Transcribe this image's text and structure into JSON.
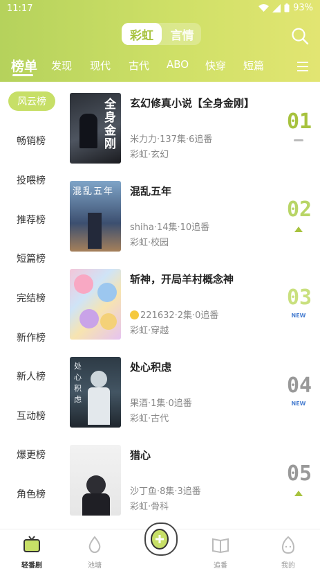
{
  "status": {
    "time": "11:17",
    "battery": "93%"
  },
  "header": {
    "segment": {
      "active": "彩虹",
      "inactive": "言情"
    },
    "tabs": [
      "榜单",
      "发现",
      "现代",
      "古代",
      "ABO",
      "快穿",
      "短篇"
    ]
  },
  "sidebar": {
    "items": [
      "风云榜",
      "畅销榜",
      "投喂榜",
      "推荐榜",
      "短篇榜",
      "完结榜",
      "新作榜",
      "新人榜",
      "互动榜",
      "爆更榜",
      "角色榜"
    ]
  },
  "books": [
    {
      "title": "玄幻修真小说【全身金刚】",
      "meta1": "米力力·137集·6追番",
      "meta2": "彩虹·玄幻",
      "rank": "01",
      "trend": "same",
      "rank_color": "#a7c23e",
      "cover_text": "全身金刚"
    },
    {
      "title": "混乱五年",
      "meta1": "shiha·14集·10追番",
      "meta2": "彩虹·校园",
      "rank": "02",
      "trend": "up",
      "rank_color": "#b8d566",
      "cover_text": "混乱五年"
    },
    {
      "title": "斩神，开局羊村概念神",
      "meta1": "221632·2集·0追番",
      "meta2": "彩虹·穿越",
      "rank": "03",
      "trend": "new",
      "trend_label": "NEW",
      "rank_color": "#c9e07e",
      "cover_text": ""
    },
    {
      "title": "处心积虑",
      "meta1": "果酒·1集·0追番",
      "meta2": "彩虹·古代",
      "rank": "04",
      "trend": "new",
      "trend_label": "NEW",
      "rank_color": "#999999",
      "cover_text": "处心积虑"
    },
    {
      "title": "猎心",
      "meta1": "沙丁鱼·8集·3追番",
      "meta2": "彩虹·骨科",
      "rank": "05",
      "trend": "up",
      "rank_color": "#999999",
      "cover_text": ""
    }
  ],
  "bottom_nav": [
    {
      "label": "轻番剧",
      "icon": "tv-icon",
      "active": true
    },
    {
      "label": "池塘",
      "icon": "drop-icon",
      "active": false
    },
    {
      "label": "",
      "icon": "add-pear-icon",
      "active": false
    },
    {
      "label": "追番",
      "icon": "book-icon",
      "active": false
    },
    {
      "label": "我的",
      "icon": "pear-face-icon",
      "active": false
    }
  ]
}
